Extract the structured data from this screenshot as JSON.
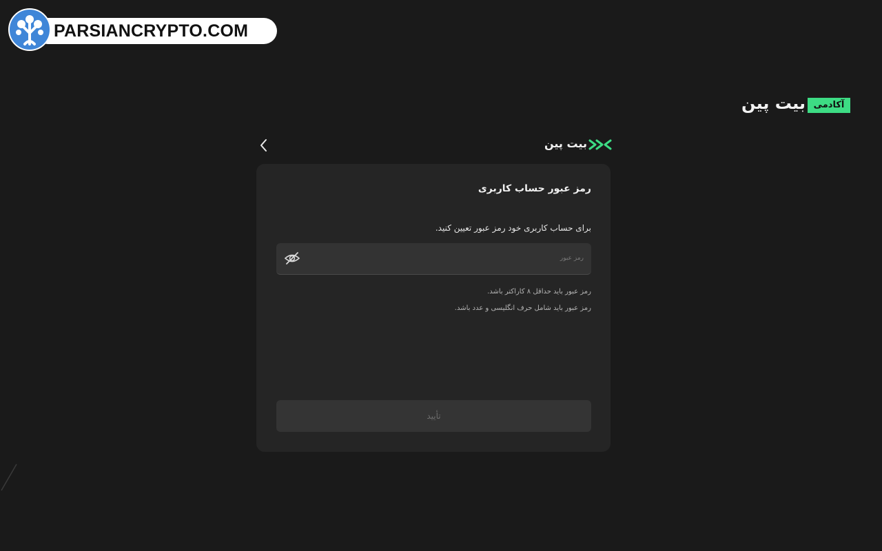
{
  "watermark": {
    "text": "PARSIANCRYPTO.COM"
  },
  "academy_logo": {
    "wordmark": "بیت پین",
    "badge": "آکادمی"
  },
  "header": {
    "brand": "بیت پین"
  },
  "card": {
    "title": "رمز عبور حساب کاربری",
    "description": "برای حساب کاربری خود رمز عبور تعیین کنید.",
    "password_field": {
      "placeholder": "رمز عبور",
      "value": ""
    },
    "hints": [
      "رمز عبور باید حداقل ۸ کاراکتر باشد.",
      "رمز عبور باید شامل حرف انگلیسی و عدد باشد."
    ],
    "submit_label": "تأیید"
  },
  "colors": {
    "background": "#1a1a1a",
    "card": "#252525",
    "field": "#333333",
    "accent": "#3ddc84",
    "watermark_blue": "#3f86d8"
  },
  "icons": {
    "back": "chevron-left-icon",
    "password_visibility": "eye-off-icon",
    "brand_mark": "bitpin-logo-icon",
    "watermark_logo": "tree-logo-icon"
  }
}
